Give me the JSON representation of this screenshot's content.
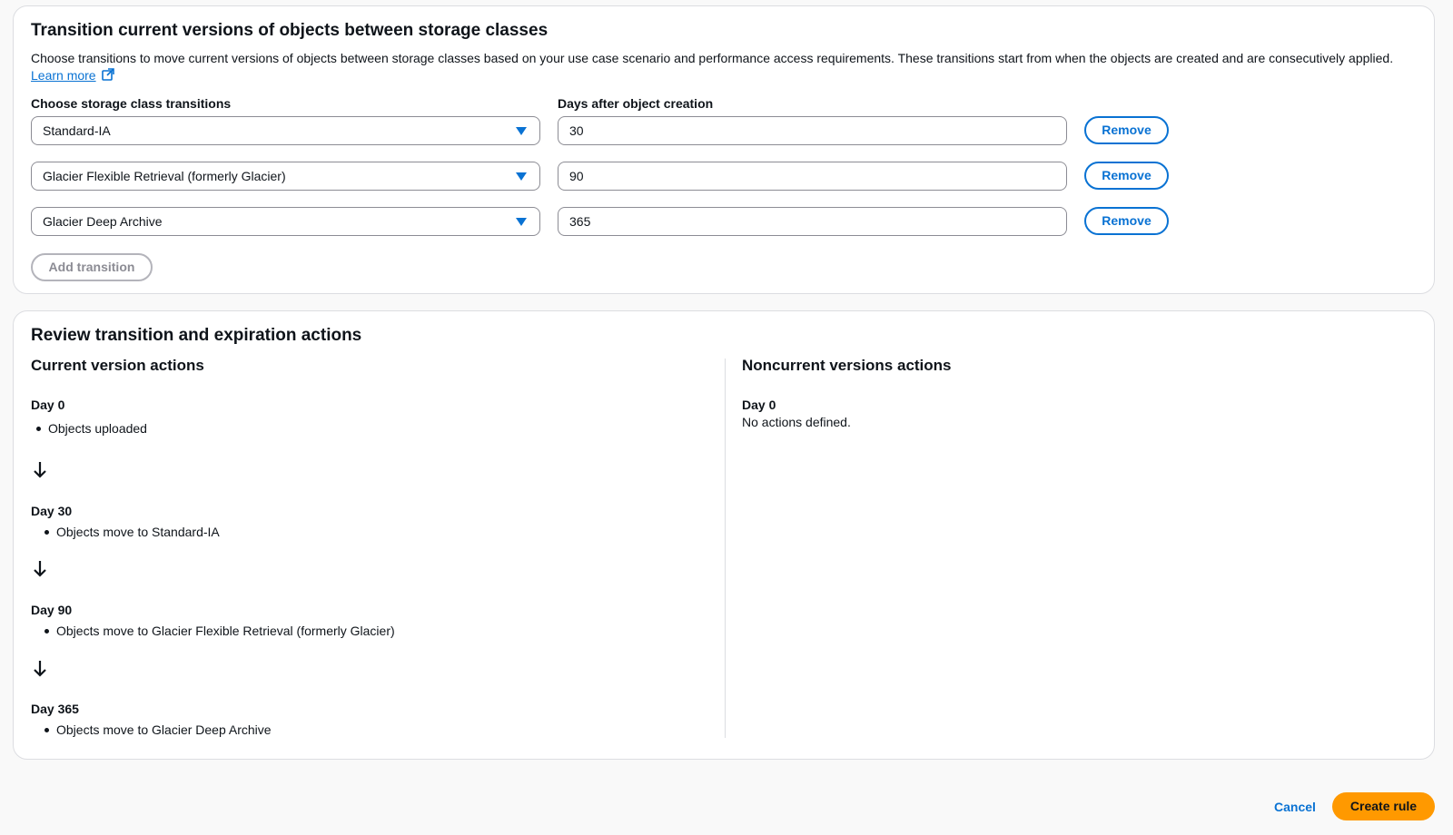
{
  "transitions_section": {
    "title": "Transition current versions of objects between storage classes",
    "description": "Choose transitions to move current versions of objects between storage classes based on your use case scenario and performance access requirements. These transitions start from when the objects are created and are consecutively applied.",
    "learn_more_label": "Learn more",
    "storage_class_label": "Choose storage class transitions",
    "days_label": "Days after object creation",
    "rows": [
      {
        "storage_class": "Standard-IA",
        "days": "30",
        "remove_label": "Remove"
      },
      {
        "storage_class": "Glacier Flexible Retrieval (formerly Glacier)",
        "days": "90",
        "remove_label": "Remove"
      },
      {
        "storage_class": "Glacier Deep Archive",
        "days": "365",
        "remove_label": "Remove"
      }
    ],
    "add_transition_label": "Add transition"
  },
  "review_section": {
    "title": "Review transition and expiration actions",
    "current": {
      "heading": "Current version actions",
      "steps": [
        {
          "day": "Day 0",
          "action": "Objects uploaded"
        },
        {
          "day": "Day 30",
          "action": "Objects move to Standard-IA"
        },
        {
          "day": "Day 90",
          "action": "Objects move to Glacier Flexible Retrieval (formerly Glacier)"
        },
        {
          "day": "Day 365",
          "action": "Objects move to Glacier Deep Archive"
        }
      ]
    },
    "noncurrent": {
      "heading": "Noncurrent versions actions",
      "day": "Day 0",
      "text": "No actions defined."
    }
  },
  "footer": {
    "cancel_label": "Cancel",
    "create_label": "Create rule"
  },
  "colors": {
    "link": "#0972d3",
    "primary": "#ff9900",
    "border": "#dcdde1"
  },
  "icons": {
    "external_link": "external-link-icon",
    "dropdown": "caret-down-icon",
    "arrow": "arrow-down-icon"
  }
}
